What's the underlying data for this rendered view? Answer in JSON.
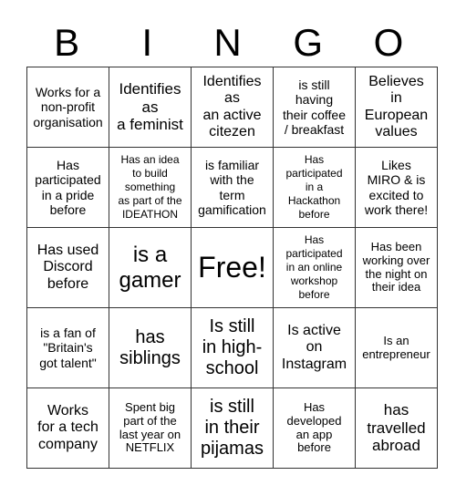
{
  "header": {
    "letters": [
      "B",
      "I",
      "N",
      "G",
      "O"
    ]
  },
  "board": {
    "rows": [
      [
        "Works for a\nnon-profit\norganisation",
        "Identifies\nas\na feminist",
        "Identifies\nas\nan active\ncitezen",
        "is still\nhaving\ntheir coffee\n/ breakfast",
        "Believes\nin\nEuropean\nvalues"
      ],
      [
        "Has\nparticipated\nin a pride\nbefore",
        "Has an idea\nto build\nsomething\nas part of the\nIDEATHON",
        "is familiar\nwith the\nterm\ngamification",
        "Has\nparticipated\nin a\nHackathon\nbefore",
        "Likes\nMIRO & is\nexcited to\nwork there!"
      ],
      [
        "Has used\nDiscord\nbefore",
        "is a\ngamer",
        "Free!",
        "Has\nparticipated\nin an online\nworkshop\nbefore",
        "Has been\nworking over\nthe night on\ntheir idea"
      ],
      [
        "is a fan of\n\"Britain's\ngot talent\"",
        "has\nsiblings",
        "Is still\nin high-\nschool",
        "Is active\non\nInstagram",
        "Is an\nentrepreneur"
      ],
      [
        "Works\nfor a tech\ncompany",
        "Spent big\npart of the\nlast year on\nNETFLIX",
        "is still\nin their\npijamas",
        "Has\ndeveloped\nan app\nbefore",
        "has\ntravelled\nabroad"
      ]
    ]
  }
}
